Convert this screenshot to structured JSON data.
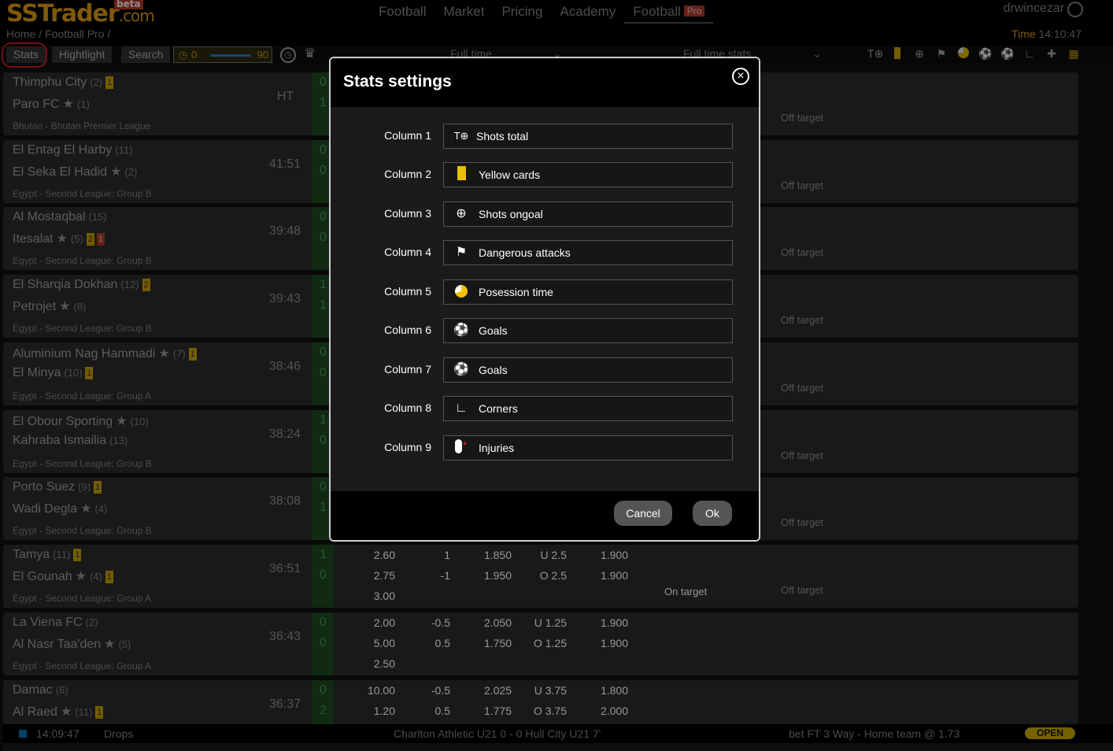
{
  "header": {
    "logo_main": "SSTrader",
    "logo_suffix": ".com",
    "logo_badge": "beta",
    "nav": [
      "Football",
      "Market",
      "Pricing",
      "Academy",
      "Football"
    ],
    "nav_pro_badge": "Pro",
    "username": "drwincezar",
    "breadcrumb": "Home  /  Football Pro  /",
    "time_label": "Time",
    "time_value": "14:10:47"
  },
  "toolbar": {
    "stats": "Stats",
    "highlight": "Hightlight",
    "search": "Search",
    "range_min": "0",
    "range_max": "90",
    "period": "Full time",
    "period_stats": "Full time stats"
  },
  "matches": [
    {
      "home": "Thimphu City",
      "home_pos": "(2)",
      "away": "Paro FC",
      "away_pos": "(1)",
      "league": "Bhutan - Bhutan Premier League",
      "time": "HT",
      "score_home": "0",
      "score_away": "1"
    },
    {
      "home": "El Entag El Harby",
      "home_pos": "(11)",
      "away": "El Seka El Hadid",
      "away_pos": "(2)",
      "league": "Egypt - Second League: Group B",
      "time": "41:51",
      "score_home": "0",
      "score_away": "0"
    },
    {
      "home": "Al Mostaqbal",
      "home_pos": "(15)",
      "away": "Itesalat",
      "away_pos": "(5)",
      "league": "Egypt - Second League: Group B",
      "time": "39:48",
      "score_home": "0",
      "score_away": "0"
    },
    {
      "home": "El Sharqia Dokhan",
      "home_pos": "(12)",
      "away": "Petrojet",
      "away_pos": "(8)",
      "league": "Egypt - Second League: Group B",
      "time": "39:43",
      "score_home": "1",
      "score_away": "1"
    },
    {
      "home": "Aluminium Nag Hammadi",
      "home_pos": "(7)",
      "away": "El Minya",
      "away_pos": "(10)",
      "league": "Egypt - Second League: Group A",
      "time": "38:46",
      "score_home": "0",
      "score_away": "0"
    },
    {
      "home": "El Obour Sporting",
      "home_pos": "(10)",
      "away": "Kahraba Ismailia",
      "away_pos": "(13)",
      "league": "Egypt - Second League: Group B",
      "time": "38:24",
      "score_home": "1",
      "score_away": "0"
    },
    {
      "home": "Porto Suez",
      "home_pos": "(9)",
      "away": "Wadi Degla",
      "away_pos": "(4)",
      "league": "Egypt - Second League: Group B",
      "time": "38:08",
      "score_home": "0",
      "score_away": "1"
    },
    {
      "home": "Tamya",
      "home_pos": "(11)",
      "away": "El Gounah",
      "away_pos": "(4)",
      "league": "Egypt - Second League: Group A",
      "time": "36:51",
      "score_home": "1",
      "score_away": "0"
    },
    {
      "home": "La Viena FC",
      "home_pos": "(2)",
      "away": "Al Nasr Taa'den",
      "away_pos": "(5)",
      "league": "Egypt - Second League: Group A",
      "time": "36:43",
      "score_home": "0",
      "score_away": "0"
    },
    {
      "home": "Damac",
      "home_pos": "(6)",
      "away": "Al Raed",
      "away_pos": "(11)",
      "league": "",
      "time": "36:37",
      "score_home": "0",
      "score_away": "2"
    }
  ],
  "odds_rows": [
    {
      "o1": "2.60",
      "o2": "2.75",
      "o3": "3.00",
      "h1": "1",
      "h2": "-1",
      "p1": "1.850",
      "p2": "1.950",
      "ou1": "U 2.5",
      "ou2": "O 2.5",
      "q1": "1.900",
      "q2": "1.900"
    },
    {
      "o1": "2.00",
      "o2": "5.00",
      "o3": "2.50",
      "h1": "-0.5",
      "h2": "0.5",
      "p1": "2.050",
      "p2": "1.750",
      "ou1": "U 1.25",
      "ou2": "O 1.25",
      "q1": "1.900",
      "q2": "1.900"
    },
    {
      "o1": "10.00",
      "o2": "1.20",
      "o3": "",
      "h1": "-0.5",
      "h2": "0.5",
      "p1": "2.025",
      "p2": "1.775",
      "ou1": "U 3.75",
      "ou2": "O 3.75",
      "q1": "1.800",
      "q2": "2.000"
    }
  ],
  "labels": {
    "off_target": "Off target",
    "on_target": "On target"
  },
  "modal": {
    "title": "Stats settings",
    "columns": [
      {
        "label": "Column 1",
        "value": "Shots total",
        "icon": "shots-total-icon"
      },
      {
        "label": "Column 2",
        "value": "Yellow cards",
        "icon": "yellow-card-icon"
      },
      {
        "label": "Column 3",
        "value": "Shots ongoal",
        "icon": "crosshair-icon"
      },
      {
        "label": "Column 4",
        "value": "Dangerous attacks",
        "icon": "dangerous-attack-icon"
      },
      {
        "label": "Column 5",
        "value": "Posession time",
        "icon": "pie-icon"
      },
      {
        "label": "Column 6",
        "value": "Goals",
        "icon": "ball-icon"
      },
      {
        "label": "Column 7",
        "value": "Goals",
        "icon": "ball-icon"
      },
      {
        "label": "Column 8",
        "value": "Corners",
        "icon": "corner-icon"
      },
      {
        "label": "Column 9",
        "value": "Injuries",
        "icon": "injury-icon"
      }
    ],
    "cancel": "Cancel",
    "ok": "Ok"
  },
  "statusbar": {
    "time": "14:09:47",
    "drops": "Drops",
    "ticker": "Charlton Athletic U21 0 - 0 Hull City U21 7'",
    "bet": "bet FT 3 Way - Home team @ 1.73",
    "open": "OPEN"
  },
  "colors": {
    "accent": "#e8a317",
    "pro": "#c0392b",
    "score_bg": "#1f4d22",
    "highlight_yellow": "#5c5012",
    "highlight_red": "#6e1c1c"
  }
}
